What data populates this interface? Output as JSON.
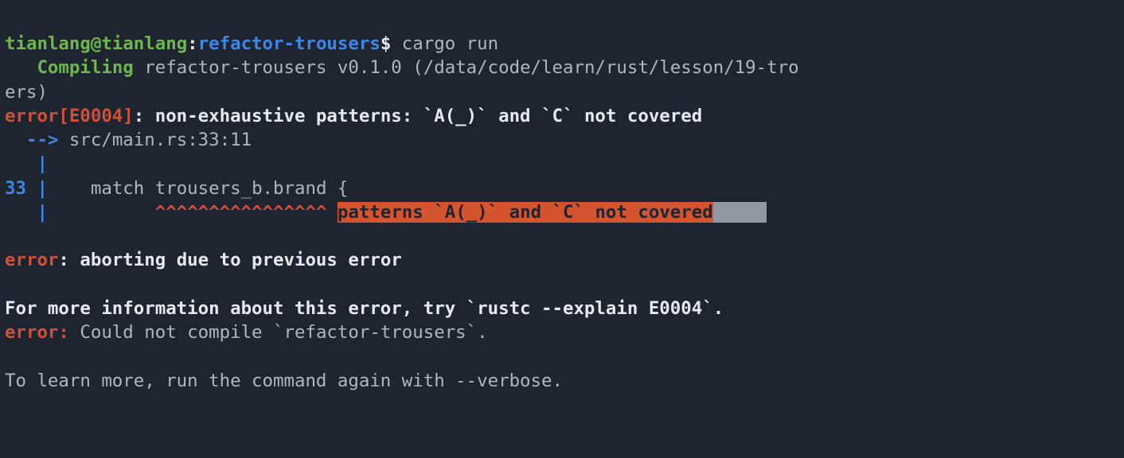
{
  "prompt": {
    "user": "tianlang",
    "host": "tianlang",
    "dir": "refactor-trousers",
    "cmd": "cargo run"
  },
  "compile": {
    "label": "Compiling",
    "rest": " refactor-trousers v0.1.0 (/data/code/learn/rust/lesson/19-tro",
    "wrap": "ers)"
  },
  "err1": {
    "head": "error[E0004]",
    "msg": ": non-exhaustive patterns: `A(_)` and `C` not covered"
  },
  "loc": {
    "arrow": "-->",
    "path": "src/main.rs:33:11"
  },
  "gutter": {
    "pipe": "|",
    "lineno": "33",
    "code": "    match trousers_b.brand {"
  },
  "caret": {
    "carets": "^^^^^^^^^^^^^^^^",
    "hlmsg": "patterns `A(_)` and `C` not covered",
    "tail_pad": "     "
  },
  "err2": {
    "head": "error",
    "msg": ": aborting due to previous error"
  },
  "info1": "For more information about this error, try `rustc --explain E0004`.",
  "err3": {
    "head": "error:",
    "msg": " Could not compile `refactor-trousers`."
  },
  "info2": "To learn more, run the command again with --verbose."
}
